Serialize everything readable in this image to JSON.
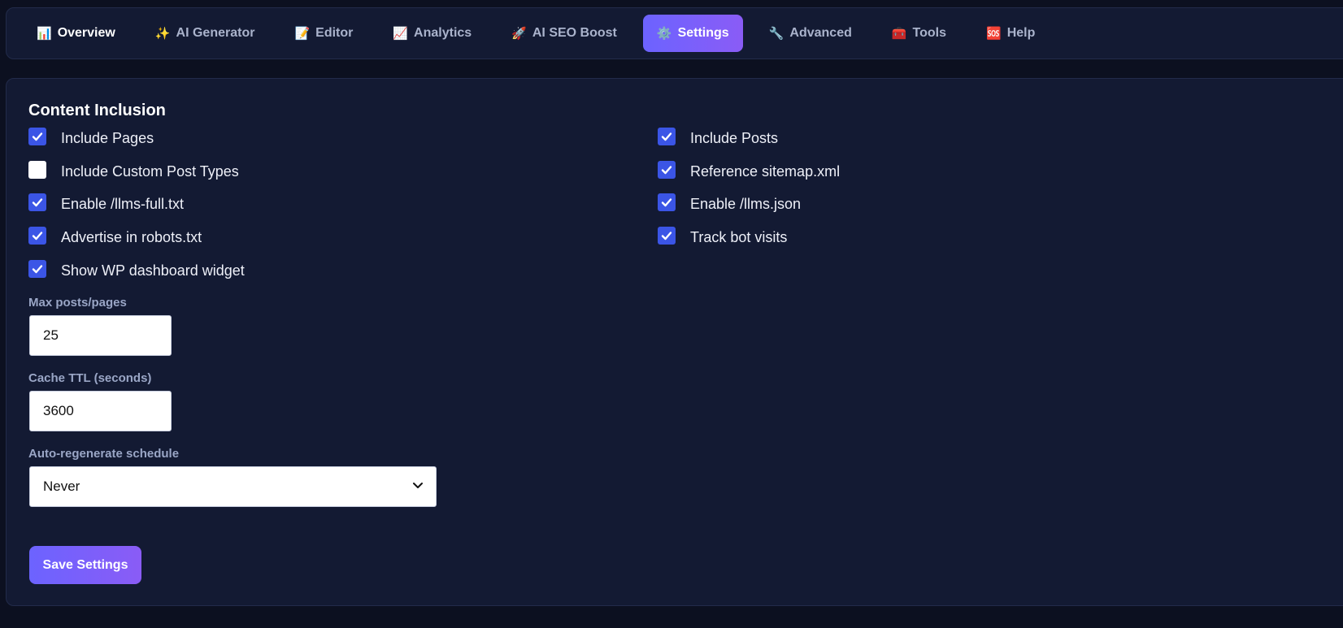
{
  "tabs": [
    {
      "icon": "📊",
      "icon_name": "bar-chart-icon",
      "label": "Overview"
    },
    {
      "icon": "✨",
      "icon_name": "sparkles-icon",
      "label": "AI Generator"
    },
    {
      "icon": "📝",
      "icon_name": "memo-icon",
      "label": "Editor"
    },
    {
      "icon": "📈",
      "icon_name": "trend-chart-icon",
      "label": "Analytics"
    },
    {
      "icon": "🚀",
      "icon_name": "rocket-icon",
      "label": "AI SEO Boost"
    },
    {
      "icon": "⚙️",
      "icon_name": "gear-icon",
      "label": "Settings",
      "active": true
    },
    {
      "icon": "🔧",
      "icon_name": "wrench-icon",
      "label": "Advanced"
    },
    {
      "icon": "🧰",
      "icon_name": "toolbox-icon",
      "label": "Tools"
    },
    {
      "icon": "🆘",
      "icon_name": "sos-icon",
      "label": "Help"
    }
  ],
  "section": {
    "title": "Content Inclusion"
  },
  "options": [
    {
      "label": "Include Pages",
      "checked": true
    },
    {
      "label": "Include Posts",
      "checked": true
    },
    {
      "label": "Include Custom Post Types",
      "checked": false
    },
    {
      "label": "Reference sitemap.xml",
      "checked": true
    },
    {
      "label": "Enable /llms-full.txt",
      "checked": true
    },
    {
      "label": "Enable /llms.json",
      "checked": true
    },
    {
      "label": "Advertise in robots.txt",
      "checked": true
    },
    {
      "label": "Track bot visits",
      "checked": true
    },
    {
      "label": "Show WP dashboard widget",
      "checked": true
    }
  ],
  "fields": {
    "max_posts": {
      "label": "Max posts/pages",
      "value": "25"
    },
    "cache_ttl": {
      "label": "Cache TTL (seconds)",
      "value": "3600"
    },
    "schedule": {
      "label": "Auto-regenerate schedule",
      "value": "Never"
    }
  },
  "save_button": {
    "label": "Save Settings"
  },
  "colors": {
    "accent_start": "#6c63ff",
    "accent_end": "#8a5cf6",
    "checkbox": "#3b55e6",
    "panel": "#131a33",
    "background": "#0c1020"
  }
}
